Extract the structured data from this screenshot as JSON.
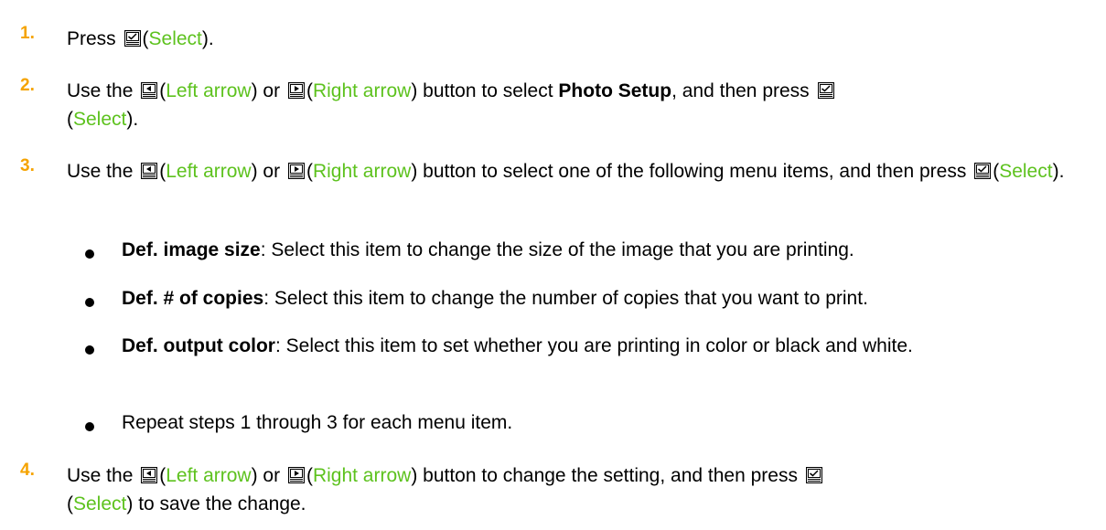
{
  "colors": {
    "step_number": "#F5A300",
    "button_name": "#5DC21E",
    "text": "#000000"
  },
  "icons": {
    "select": "select-button-icon",
    "left": "left-arrow-button-icon",
    "right": "right-arrow-button-icon"
  },
  "steps": [
    {
      "number": "1.",
      "t1": "Press ",
      "b1": "Select",
      "t2": "."
    },
    {
      "number": "2.",
      "t1": "Use the ",
      "b1": "Left arrow",
      "t2": " or ",
      "b2": "Right arrow",
      "t3": " button to select ",
      "bold": "Photo Setup",
      "t4": ", and then press ",
      "b3": "Select",
      "t5": "."
    },
    {
      "number": "3.",
      "t1": "Use the ",
      "b1": "Left arrow",
      "t2": " or ",
      "b2": "Right arrow",
      "t3": " button to select one of the following menu items, and then press ",
      "b3": "Select",
      "t4": "."
    },
    {
      "number": "4.",
      "t1": "Use the ",
      "b1": "Left arrow",
      "t2": " or ",
      "b2": "Right arrow",
      "t3": " button to change the setting, and then press ",
      "b3": "Select",
      "t4": " to save the change."
    }
  ],
  "bullets": [
    {
      "term": "Def. image size",
      "text": ": Select this item to change the size of the image that you are printing."
    },
    {
      "term": "Def. # of copies",
      "text": ": Select this item to change the number of copies that you want to print."
    },
    {
      "term": "Def. output color",
      "text": ": Select this item to set whether you are printing in color or black and white."
    },
    {
      "term": "",
      "text": "Repeat steps 1 through 3 for each menu item."
    }
  ]
}
